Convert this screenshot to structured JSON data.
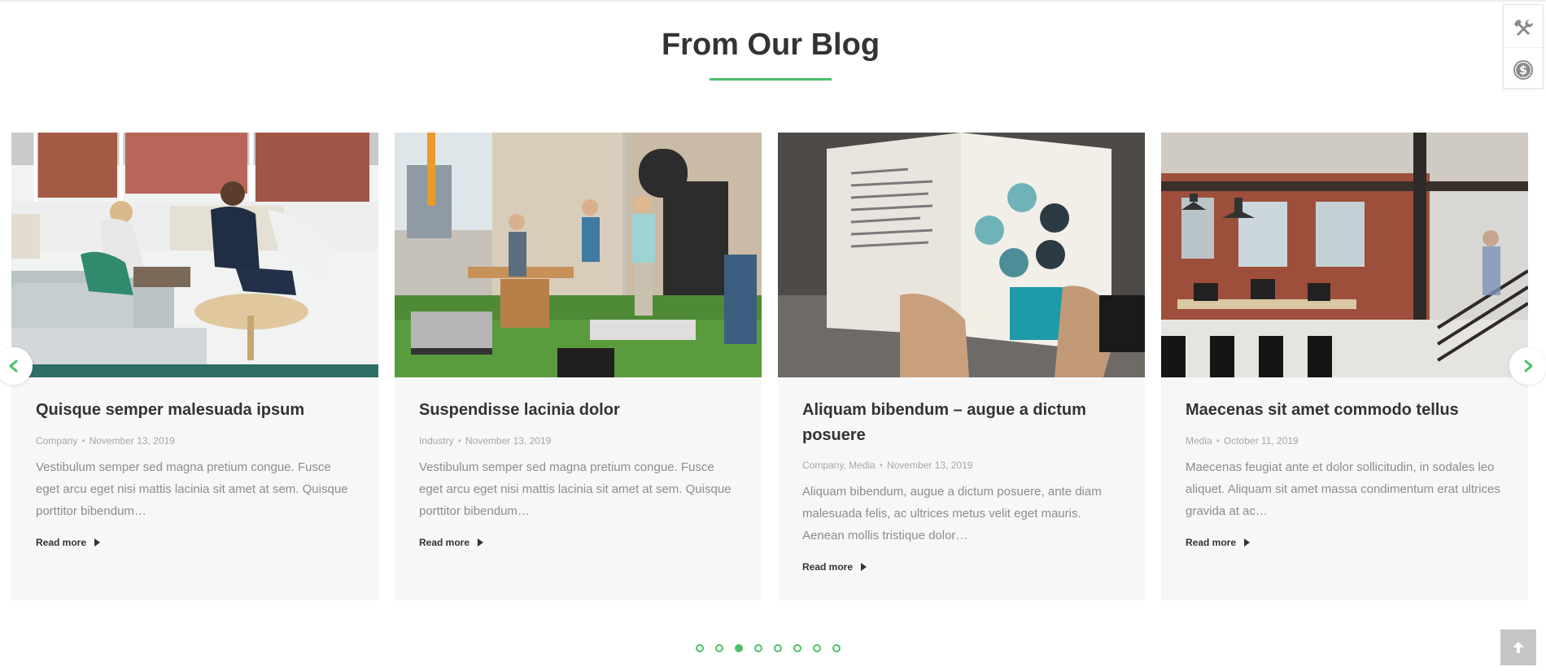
{
  "section": {
    "title": "From Our Blog"
  },
  "posts": [
    {
      "title": "Quisque semper malesuada ipsum",
      "categories": "Company",
      "date": "November 13, 2019",
      "excerpt": "Vestibulum semper sed magna pretium congue. Fusce eget arcu eget nisi mattis lacinia sit amet at sem. Quisque porttitor bibendum…",
      "read_more": "Read more"
    },
    {
      "title": "Suspendisse lacinia dolor",
      "categories": "Industry",
      "date": "November 13, 2019",
      "excerpt": "Vestibulum semper sed magna pretium congue. Fusce eget arcu eget nisi mattis lacinia sit amet at sem. Quisque porttitor bibendum…",
      "read_more": "Read more"
    },
    {
      "title": "Aliquam bibendum – augue a dictum posuere",
      "categories": "Company, Media",
      "date": "November 13, 2019",
      "excerpt": "Aliquam bibendum, augue a dictum posuere, ante diam malesuada felis, ac ultrices metus velit eget mauris. Aenean mollis tristique dolor…",
      "read_more": "Read more"
    },
    {
      "title": "Maecenas sit amet commodo tellus",
      "categories": "Media",
      "date": "October 11, 2019",
      "excerpt": "Maecenas feugiat ante et dolor sollicitudin, in sodales leo aliquet. Aliquam sit amet massa condimentum erat ultrices gravida at ac…",
      "read_more": "Read more"
    }
  ],
  "pagination": {
    "total": 8,
    "active_index": 2
  },
  "icons": {
    "prev": "chevron-left-icon",
    "next": "chevron-right-icon",
    "tools": "tools-icon",
    "dollar": "dollar-icon",
    "back_to_top": "arrow-up-icon"
  },
  "colors": {
    "accent": "#4dbf6e",
    "card_bg": "#f7f7f7",
    "title": "#333333",
    "meta": "#a7a7a7",
    "excerpt": "#8c8c8c"
  }
}
